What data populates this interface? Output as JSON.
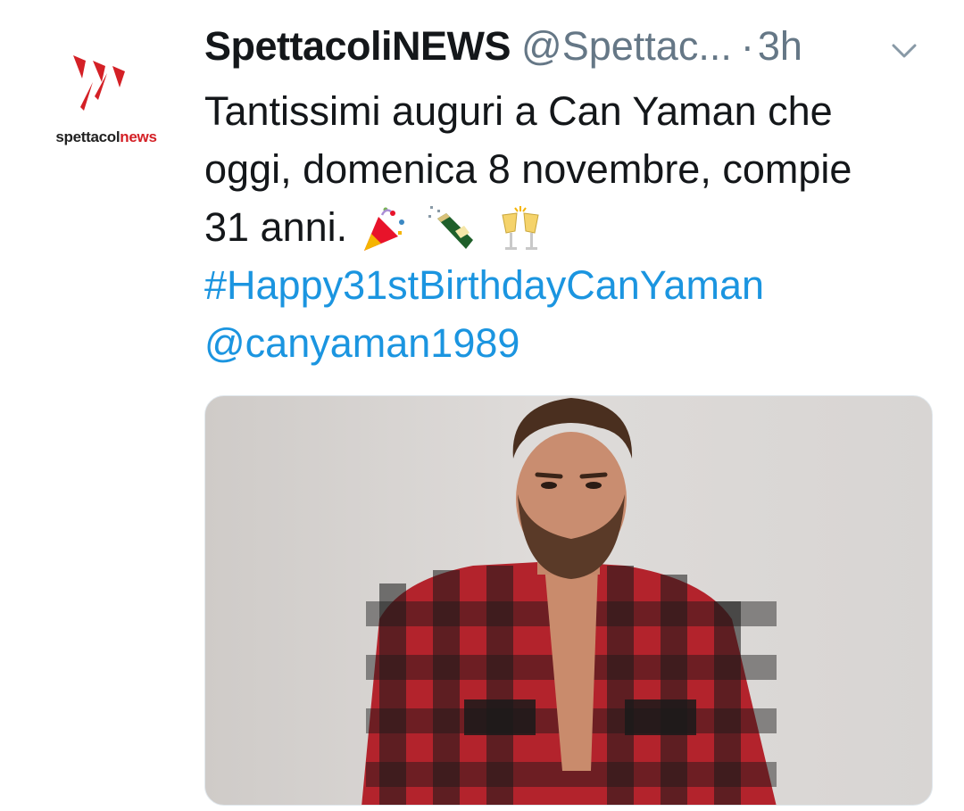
{
  "account": {
    "display_name": "SpettacoliNEWS",
    "handle": "@Spettac...",
    "separator": "·",
    "time": "3h",
    "avatar_brand_part1": "spettacol",
    "avatar_brand_part2": "news"
  },
  "tweet": {
    "line1": "Tantissimi auguri a Can Yaman che",
    "line2": "oggi, domenica 8 novembre, compie",
    "line3": "31 anni.",
    "emojis": [
      "party-popper-icon",
      "champagne-bottle-icon",
      "clinking-glasses-icon"
    ],
    "hashtag": "#Happy31stBirthdayCanYaman",
    "mention": "@canyaman1989"
  },
  "colors": {
    "link": "#1b95e0",
    "text": "#14171a",
    "secondary": "#657786",
    "brand_red": "#d42026"
  }
}
